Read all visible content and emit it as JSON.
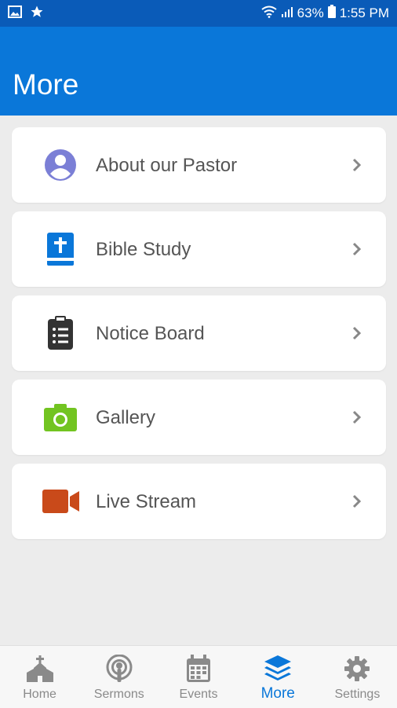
{
  "status_bar": {
    "battery": "63%",
    "time": "1:55 PM",
    "left_icons": [
      "image-icon",
      "star-icon"
    ],
    "right_icons": [
      "wifi-icon",
      "signal-icon",
      "battery-icon"
    ]
  },
  "header": {
    "title": "More"
  },
  "items": [
    {
      "label": "About our Pastor",
      "icon": "person-circle-icon",
      "color": "#7b7fd6"
    },
    {
      "label": "Bible Study",
      "icon": "bible-icon",
      "color": "#0a77d9"
    },
    {
      "label": "Notice Board",
      "icon": "clipboard-list-icon",
      "color": "#333333"
    },
    {
      "label": "Gallery",
      "icon": "camera-icon",
      "color": "#72c421"
    },
    {
      "label": "Live Stream",
      "icon": "video-camera-icon",
      "color": "#c94a1a"
    }
  ],
  "bottom_nav": {
    "items": [
      {
        "label": "Home",
        "icon": "church-icon"
      },
      {
        "label": "Sermons",
        "icon": "podcast-icon"
      },
      {
        "label": "Events",
        "icon": "calendar-icon"
      },
      {
        "label": "More",
        "icon": "layers-icon",
        "active": true
      },
      {
        "label": "Settings",
        "icon": "gear-icon"
      }
    ],
    "active_color": "#0a77d9",
    "inactive_color": "#8a8a8a"
  }
}
